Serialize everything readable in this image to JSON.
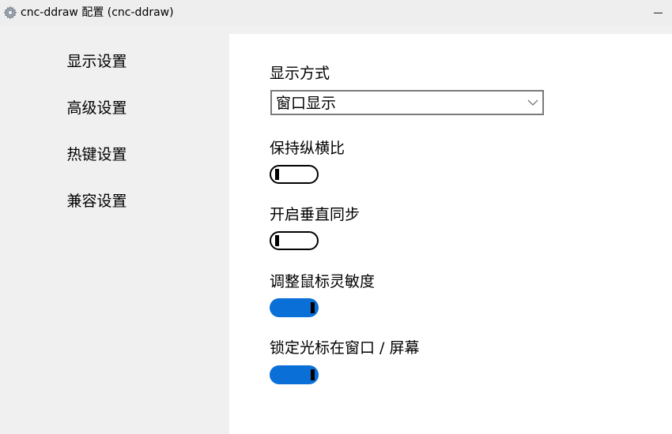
{
  "window": {
    "title": "cnc-ddraw 配置  (cnc-ddraw)",
    "icon": "gear-icon",
    "minimize_label": "minimize"
  },
  "sidebar": {
    "items": [
      {
        "label": "显示设置"
      },
      {
        "label": "高级设置"
      },
      {
        "label": "热键设置"
      },
      {
        "label": "兼容设置"
      }
    ]
  },
  "settings": {
    "display_mode": {
      "label": "显示方式",
      "value": "窗口显示"
    },
    "toggles": [
      {
        "label": "保持纵横比",
        "on": false
      },
      {
        "label": "开启垂直同步",
        "on": false
      },
      {
        "label": "调整鼠标灵敏度",
        "on": true
      },
      {
        "label": "锁定光标在窗口 / 屏幕",
        "on": true
      }
    ]
  },
  "colors": {
    "toggle_on": "#0a6fd6",
    "toggle_off_border": "#000000",
    "sidebar_bg": "#f0f0f0",
    "content_bg": "#ffffff"
  }
}
